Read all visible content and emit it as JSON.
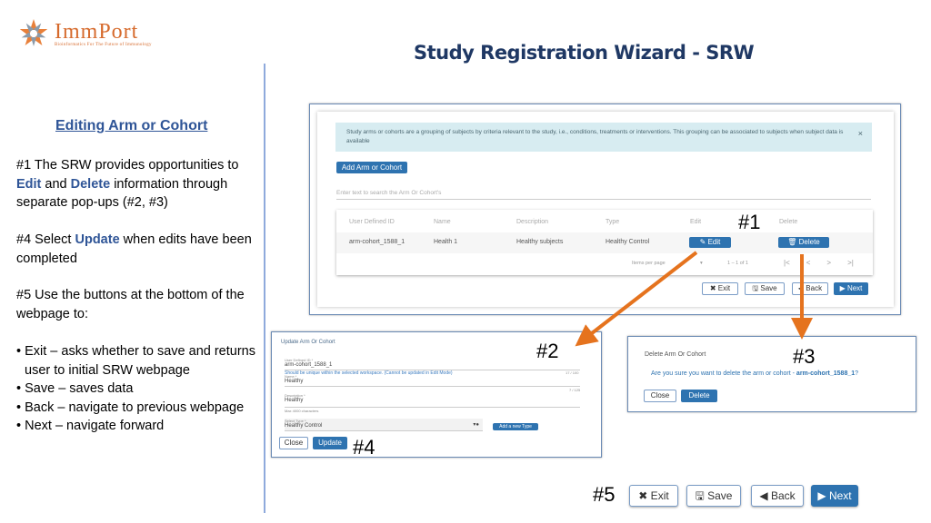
{
  "logo": {
    "name": "ImmPort",
    "tagline": "Bioinformatics For The Future of Immunology",
    "brand_color": "#d66a2c"
  },
  "title": "Study Registration Wizard - SRW",
  "left": {
    "heading": "Editing Arm or Cohort",
    "p1": {
      "a": "#1 The SRW provides opportunities to ",
      "edit": "Edit",
      "b": " and ",
      "delete": "Delete",
      "c": " information through separate pop-ups (#2, #3)"
    },
    "p2": {
      "a": "#4 Select ",
      "update": "Update",
      "b": " when edits have been completed"
    },
    "p3": "#5 Use the buttons at the bottom of the webpage to:",
    "bullets": [
      "Exit – asks whether to save and returns user to initial SRW webpage",
      "Save – saves data",
      "Back – navigate to previous webpage",
      "Next – navigate forward"
    ]
  },
  "shot1": {
    "info": "Study arms or cohorts are a grouping of subjects by criteria relevant to the study, i.e., conditions, treatments or interventions. This grouping can be associated to subjects when subject data is available",
    "close": "×",
    "add_button": "Add Arm or Cohort",
    "search_placeholder": "Enter text to search the Arm Or Cohort's",
    "columns": [
      "User Defined ID",
      "Name",
      "Description",
      "Type",
      "Edit",
      "Delete"
    ],
    "row": [
      "arm-cohort_1588_1",
      "Health 1",
      "Healthy subjects",
      "Healthy Control"
    ],
    "edit_button": "✎ Edit",
    "delete_button": "🗑 Delete",
    "items_per_page": "Items per page",
    "range": "1 – 1 of 1",
    "pager": [
      "|<",
      "<",
      ">",
      ">|"
    ],
    "buttons": [
      "✖ Exit",
      "🖫 Save",
      "◀ Back",
      "▶ Next"
    ]
  },
  "shot2": {
    "title": "Update Arm Or Cohort",
    "f1_label": "User Defined ID *",
    "f1_value": "arm-cohort_1588_1",
    "f1_hint": "Should be unique within the selected workspace. (Cannot be updated in Edit Mode)",
    "f1_count": "17 / 100",
    "f2_label": "Name *",
    "f2_value": "Healthy",
    "f2_count": "7 / 125",
    "f3_label": "Description *",
    "f3_value": "Healthy",
    "f3_hint": "Max 4000 characters",
    "f4_label": "Select Type *",
    "f4_value": "Healthy Control",
    "add_type": "Add a new Type",
    "close": "Close",
    "update": "Update"
  },
  "shot3": {
    "title": "Delete Arm Or Cohort",
    "question": "Are you sure you want to delete the arm or cohort - ",
    "target": "arm-cohort_1588_1",
    "q_end": "?",
    "close": "Close",
    "delete": "Delete"
  },
  "labels": {
    "n1": "#1",
    "n2": "#2",
    "n3": "#3",
    "n4": "#4",
    "n5": "#5"
  },
  "bottom_buttons": [
    "✖ Exit",
    "🖫 Save",
    "◀ Back",
    "▶ Next"
  ],
  "colors": {
    "accent": "#2e73b0",
    "arrow": "#e5731e",
    "title": "#1f3864"
  }
}
